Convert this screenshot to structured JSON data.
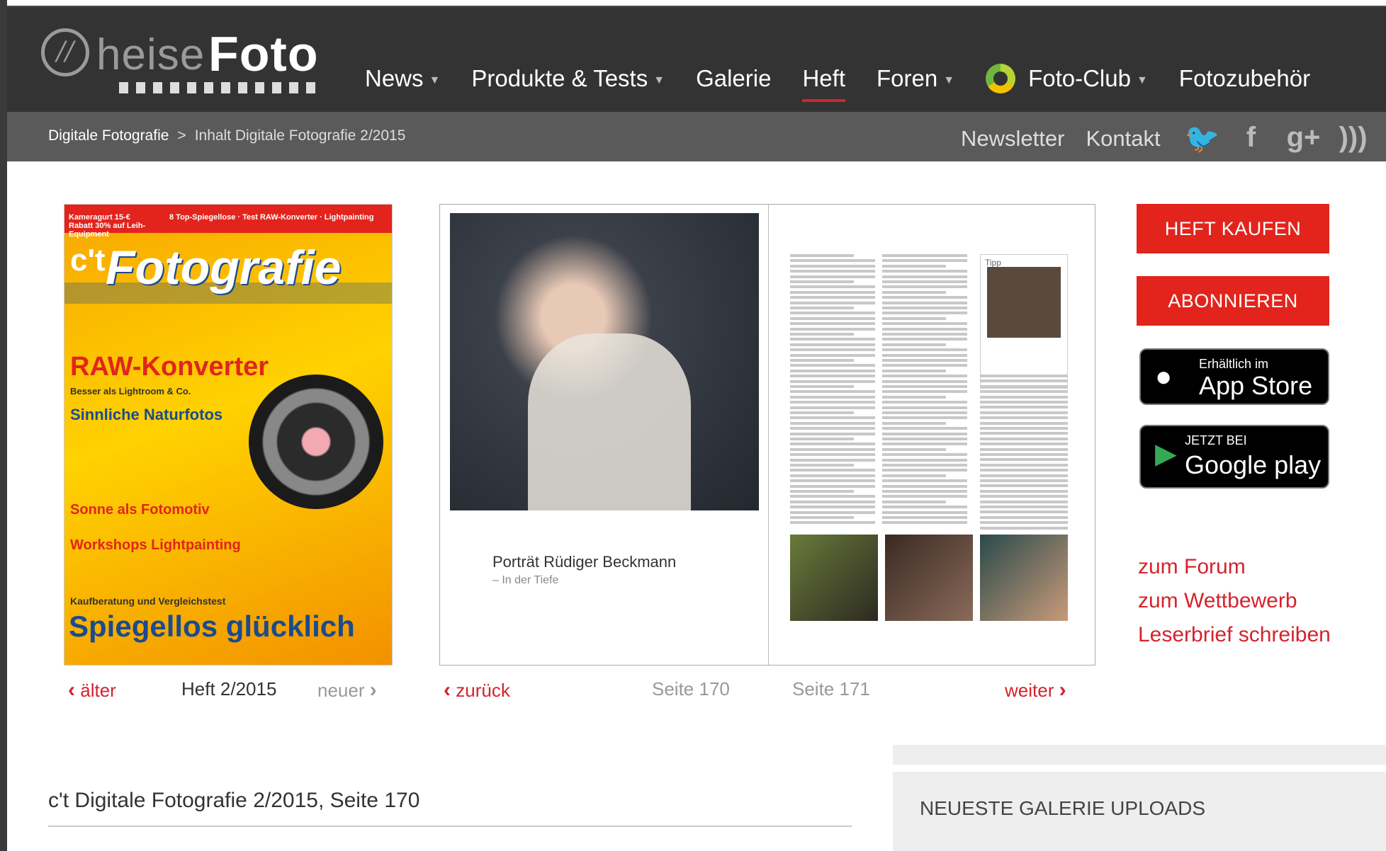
{
  "logo": {
    "heise": "heise",
    "foto": "Foto"
  },
  "nav": [
    {
      "label": "News",
      "caret": true
    },
    {
      "label": "Produkte & Tests",
      "caret": true
    },
    {
      "label": "Galerie",
      "caret": false
    },
    {
      "label": "Heft",
      "caret": false,
      "active": true
    },
    {
      "label": "Foren",
      "caret": true
    },
    {
      "label": "Foto-Club",
      "caret": true
    },
    {
      "label": "Fotozubehör",
      "caret": false
    }
  ],
  "breadcrumb": {
    "root": "Digitale Fotografie",
    "separator": ">",
    "current": "Inhalt Digitale Fotografie 2/2015"
  },
  "sublinks": {
    "newsletter": "Newsletter",
    "kontakt": "Kontakt"
  },
  "social": {
    "twitter": "twitter-icon",
    "facebook": "facebook-icon",
    "gplus": "google-plus-icon",
    "rss": "rss-icon"
  },
  "cover": {
    "banner_left": "Kameragurt 15-€ Rabatt 30% auf Leih-Equipment",
    "banner_right": "8 Top-Spiegellose · Test RAW-Konverter · Lightpainting",
    "brand": "c't",
    "title": "Fotografie",
    "raw": "RAW-Konverter",
    "raw_sub": "Besser als Lightroom & Co.",
    "natur": "Sinnliche Naturfotos",
    "sonne": "Sonne als Fotomotiv",
    "light": "Workshops Lightpainting",
    "kauf": "Kaufberatung und Vergleichstest",
    "spiegel": "Spiegellos glücklich"
  },
  "issue_nav": {
    "older": "älter",
    "issue": "Heft 2/2015",
    "newer": "neuer"
  },
  "spread": {
    "title": "Porträt Rüdiger Beckmann",
    "subtitle": "– In der Tiefe",
    "tipp": "Tipp"
  },
  "page_nav": {
    "back": "zurück",
    "page_left": "Seite 170",
    "page_right": "Seite 171",
    "forward": "weiter"
  },
  "sidebar": {
    "buy": "HEFT KAUFEN",
    "subscribe": "ABONNIEREN",
    "appstore_small": "Erhältlich im",
    "appstore_big": "App Store",
    "gplay_small": "JETZT BEI",
    "gplay_big": "Google play",
    "links": [
      "zum Forum",
      "zum Wettbewerb",
      "Leserbrief schreiben"
    ]
  },
  "page_heading": "c't Digitale Fotografie 2/2015, Seite 170",
  "gallery_heading": "NEUESTE GALERIE UPLOADS",
  "colors": {
    "accent": "#e2241c",
    "nav_bg": "#333333",
    "subnav_bg": "#5a5a5a"
  }
}
